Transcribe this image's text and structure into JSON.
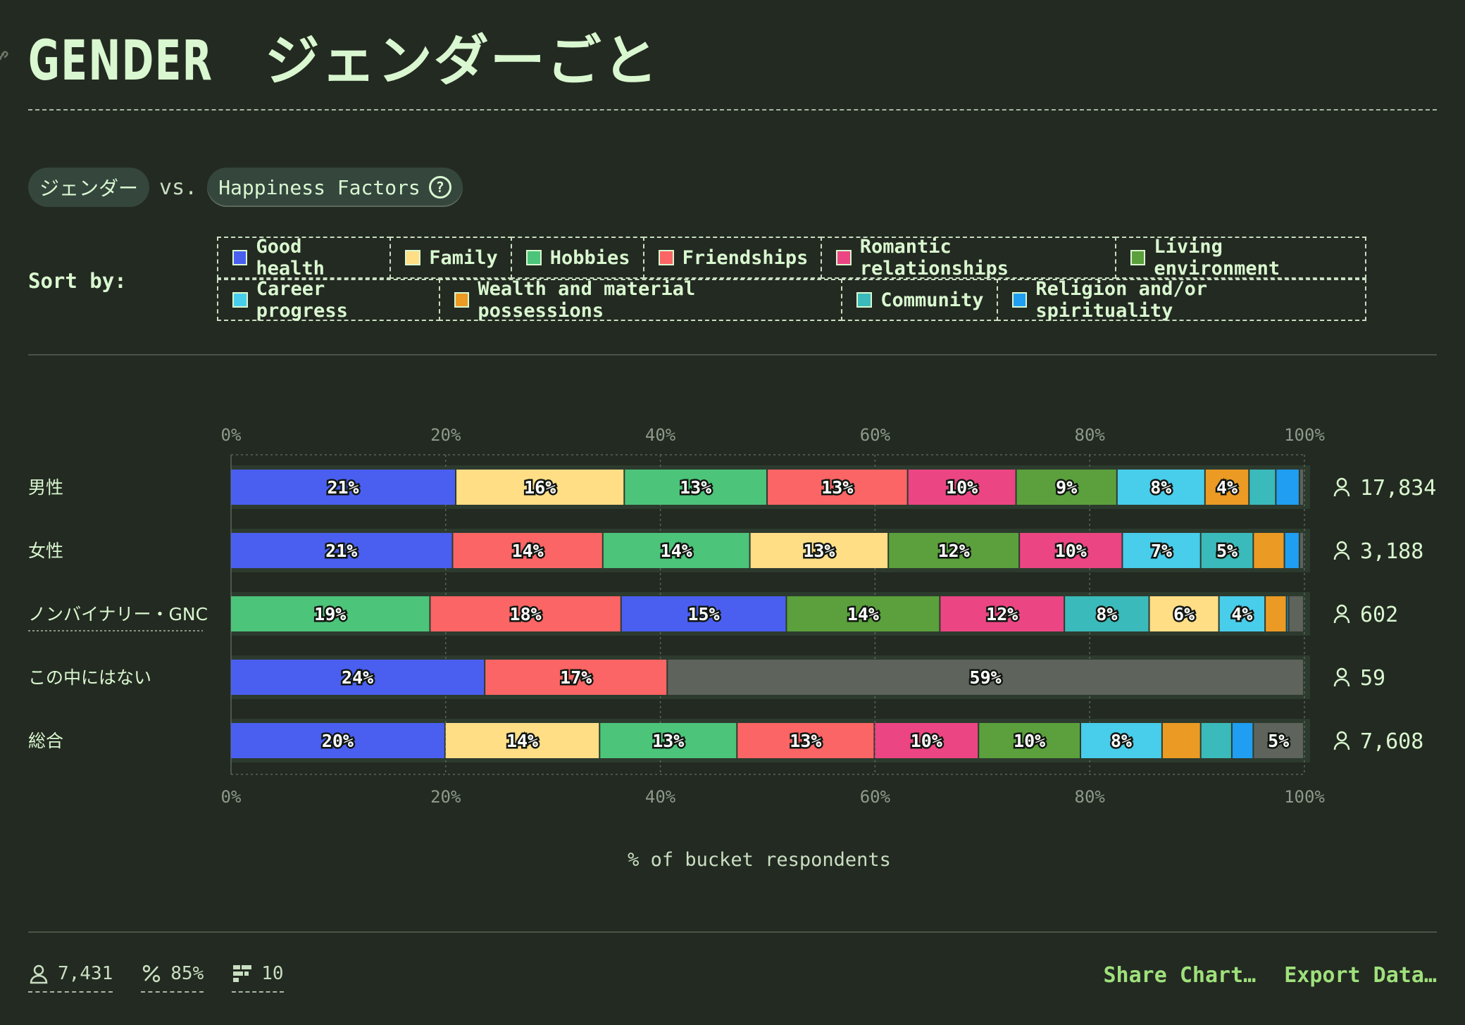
{
  "title": {
    "latin": "GENDER",
    "japanese": "ジェンダーごと"
  },
  "selectors": {
    "left": "ジェンダー",
    "vs": "vs.",
    "right": "Happiness Factors",
    "help": "?"
  },
  "sort": {
    "label": "Sort by:"
  },
  "legend": {
    "row1": [
      {
        "label": "Good health",
        "color": "#4a5ff0"
      },
      {
        "label": "Family",
        "color": "#ffde85"
      },
      {
        "label": "Hobbies",
        "color": "#4cc47a"
      },
      {
        "label": "Friendships",
        "color": "#fc6565"
      },
      {
        "label": "Romantic relationships",
        "color": "#ec4583"
      },
      {
        "label": "Living environment",
        "color": "#5ba03c"
      }
    ],
    "row2": [
      {
        "label": "Career progress",
        "color": "#48cdeb"
      },
      {
        "label": "Wealth and material possessions",
        "color": "#eb9a24"
      },
      {
        "label": "Community",
        "color": "#3ababa"
      },
      {
        "label": "Religion and/or spirituality",
        "color": "#1f9ef2"
      }
    ]
  },
  "chart_data": {
    "type": "bar",
    "orientation": "horizontal-stacked",
    "xlabel": "% of bucket respondents",
    "xlim": [
      0,
      100
    ],
    "ticks": [
      "0%",
      "20%",
      "40%",
      "60%",
      "80%",
      "100%"
    ],
    "rows": [
      {
        "label": "男性",
        "count": "17,834",
        "segments": [
          {
            "factor": "Good health",
            "value": 21,
            "label": "21%"
          },
          {
            "factor": "Family",
            "value": 15.7,
            "label": "16%"
          },
          {
            "factor": "Hobbies",
            "value": 13.3,
            "label": "13%"
          },
          {
            "factor": "Friendships",
            "value": 13.1,
            "label": "13%"
          },
          {
            "factor": "Romantic relationships",
            "value": 10.1,
            "label": "10%"
          },
          {
            "factor": "Living environment",
            "value": 9.4,
            "label": "9%"
          },
          {
            "factor": "Career progress",
            "value": 8.2,
            "label": "8%"
          },
          {
            "factor": "Wealth and material possessions",
            "value": 4.1,
            "label": "4%"
          },
          {
            "factor": "Community",
            "value": 2.5,
            "label": ""
          },
          {
            "factor": "Religion and/or spirituality",
            "value": 2.2,
            "label": ""
          },
          {
            "factor": "Other",
            "value": 0.4,
            "label": ""
          }
        ]
      },
      {
        "label": "女性",
        "count": "3,188",
        "segments": [
          {
            "factor": "Good health",
            "value": 20.7,
            "label": "21%"
          },
          {
            "factor": "Friendships",
            "value": 14.0,
            "label": "14%"
          },
          {
            "factor": "Hobbies",
            "value": 13.7,
            "label": "14%"
          },
          {
            "factor": "Family",
            "value": 12.9,
            "label": "13%"
          },
          {
            "factor": "Living environment",
            "value": 12.2,
            "label": "12%"
          },
          {
            "factor": "Romantic relationships",
            "value": 9.6,
            "label": "10%"
          },
          {
            "factor": "Career progress",
            "value": 7.3,
            "label": "7%"
          },
          {
            "factor": "Community",
            "value": 4.9,
            "label": "5%"
          },
          {
            "factor": "Wealth and material possessions",
            "value": 2.9,
            "label": ""
          },
          {
            "factor": "Religion and/or spirituality",
            "value": 1.4,
            "label": ""
          },
          {
            "factor": "Other",
            "value": 0.4,
            "label": ""
          }
        ]
      },
      {
        "label": "ノンバイナリー・GNC",
        "count": "602",
        "segments": [
          {
            "factor": "Hobbies",
            "value": 18.6,
            "label": "19%"
          },
          {
            "factor": "Friendships",
            "value": 17.8,
            "label": "18%"
          },
          {
            "factor": "Good health",
            "value": 15.4,
            "label": "15%"
          },
          {
            "factor": "Living environment",
            "value": 14.3,
            "label": "14%"
          },
          {
            "factor": "Romantic relationships",
            "value": 11.6,
            "label": "12%"
          },
          {
            "factor": "Community",
            "value": 7.9,
            "label": "8%"
          },
          {
            "factor": "Family",
            "value": 6.5,
            "label": "6%"
          },
          {
            "factor": "Career progress",
            "value": 4.3,
            "label": "4%"
          },
          {
            "factor": "Wealth and material possessions",
            "value": 2.0,
            "label": ""
          },
          {
            "factor": "Religion and/or spirituality",
            "value": 0.2,
            "label": ""
          },
          {
            "factor": "Other",
            "value": 1.4,
            "label": ""
          }
        ]
      },
      {
        "label": "この中にはない",
        "count": "59",
        "segments": [
          {
            "factor": "Good health",
            "value": 23.7,
            "label": "24%"
          },
          {
            "factor": "Friendships",
            "value": 17.0,
            "label": "17%"
          },
          {
            "factor": "Other",
            "value": 59.3,
            "label": "59%"
          }
        ]
      },
      {
        "label": "総合",
        "count": "7,608",
        "segments": [
          {
            "factor": "Good health",
            "value": 20.0,
            "label": "20%"
          },
          {
            "factor": "Family",
            "value": 14.4,
            "label": "14%"
          },
          {
            "factor": "Hobbies",
            "value": 12.8,
            "label": "13%"
          },
          {
            "factor": "Friendships",
            "value": 12.8,
            "label": "13%"
          },
          {
            "factor": "Romantic relationships",
            "value": 9.7,
            "label": "10%"
          },
          {
            "factor": "Living environment",
            "value": 9.5,
            "label": "10%"
          },
          {
            "factor": "Career progress",
            "value": 7.6,
            "label": "8%"
          },
          {
            "factor": "Wealth and material possessions",
            "value": 3.6,
            "label": ""
          },
          {
            "factor": "Community",
            "value": 2.9,
            "label": ""
          },
          {
            "factor": "Religion and/or spirituality",
            "value": 2.0,
            "label": ""
          },
          {
            "factor": "Other",
            "value": 4.7,
            "label": "5%"
          }
        ]
      }
    ],
    "colors": {
      "Good health": "#4a5ff0",
      "Family": "#ffde85",
      "Hobbies": "#4cc47a",
      "Friendships": "#fc6565",
      "Romantic relationships": "#ec4583",
      "Living environment": "#5ba03c",
      "Career progress": "#48cdeb",
      "Wealth and material possessions": "#eb9a24",
      "Community": "#3ababa",
      "Religion and/or spirituality": "#1f9ef2",
      "Other": "#5e635c"
    }
  },
  "footer": {
    "respondents": "7,431",
    "percent": "85%",
    "buckets": "10"
  },
  "actions": {
    "share": "Share Chart…",
    "export": "Export Data…"
  }
}
